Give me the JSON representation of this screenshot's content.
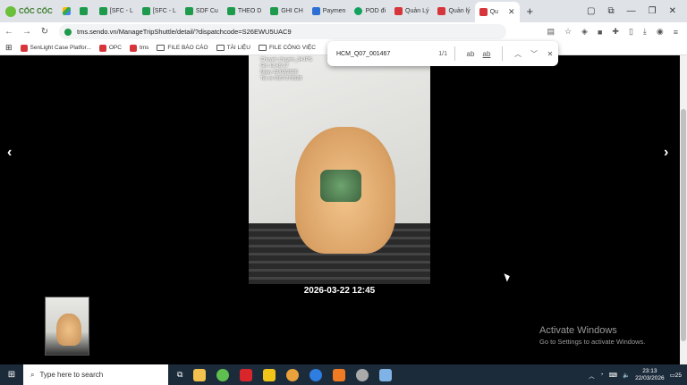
{
  "browser": {
    "brand": "CỐC CỐC",
    "tabs": [
      {
        "label": "",
        "icon": "gdrive"
      },
      {
        "label": "",
        "icon": "green"
      },
      {
        "label": "[SFC - L",
        "icon": "green"
      },
      {
        "label": "[SFC - L",
        "icon": "green"
      },
      {
        "label": "SDF Cu",
        "icon": "green"
      },
      {
        "label": "THEO D",
        "icon": "green"
      },
      {
        "label": "GHI CH",
        "icon": "green"
      },
      {
        "label": "Paymen",
        "icon": "blue"
      },
      {
        "label": "POD đi",
        "icon": "circle"
      },
      {
        "label": "Quản Lý",
        "icon": "red"
      },
      {
        "label": "Quản lý",
        "icon": "red"
      },
      {
        "label": "Qu",
        "icon": "red",
        "active": true
      }
    ],
    "url": "tms.sendo.vn/ManageTripShuttle/detail/?dispatchcode=S26EWU5UAC9",
    "bookmarks": [
      {
        "label": "SenLight Case Platfor...",
        "icon": "red"
      },
      {
        "label": "OPC",
        "icon": "red"
      },
      {
        "label": "tms",
        "icon": "red"
      },
      {
        "label": "FILE BÁO CÁO",
        "icon": "folder"
      },
      {
        "label": "TÀI LIỆU",
        "icon": "folder"
      },
      {
        "label": "FILE CÔNG VIỆC",
        "icon": "folder"
      }
    ]
  },
  "find": {
    "query": "HCM_Q07_001467",
    "count": "1/1",
    "opt1": "ab",
    "opt2": "ab"
  },
  "viewer": {
    "overlay_lines": [
      "Chuyen chuyen_34 IPS",
      "Gio 12:45:17",
      "Ngay 22/03/2026",
      "Tai xe 0057278528"
    ],
    "caption": "2026-03-22 12:45",
    "prev": "‹",
    "next": "›"
  },
  "watermark": {
    "title": "Activate Windows",
    "subtitle": "Go to Settings to activate Windows."
  },
  "taskbar": {
    "search_placeholder": "Type here to search",
    "time": "23:13",
    "date": "22/03/2026",
    "badge": "25"
  }
}
